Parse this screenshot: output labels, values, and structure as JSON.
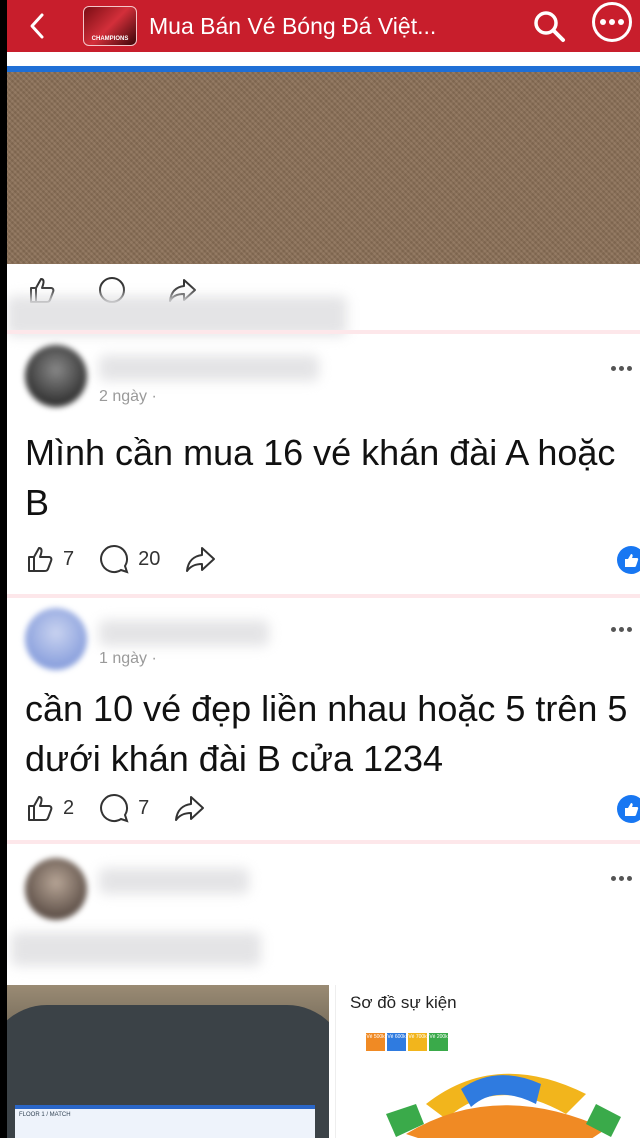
{
  "header": {
    "group_title": "Mua Bán Vé Bóng Đá Việt...",
    "avatar_caption": "CHAMPIONS",
    "icons": [
      "chevron-left-icon",
      "search-icon",
      "more-icon"
    ],
    "accent_color": "#c81e2c"
  },
  "posts": [
    {
      "meta": "2 ngày ·",
      "text": "Mình cần mua 16 vé khán đài A hoặc B",
      "likes": "7",
      "comments": "20"
    },
    {
      "meta": "1 ngày ·",
      "text": "cần 10 vé đẹp liền nhau hoặc 5 trên 5 dưới khán đài B cửa 1234",
      "likes": "2",
      "comments": "7"
    }
  ],
  "third_post": {
    "map_title": "Sơ đồ sự kiện",
    "legend": [
      "Vé 500k",
      "Vé 600k",
      "Vé 700k",
      "Vé 200k"
    ],
    "ticket_caption": "FLOOR 1 / MATCH"
  }
}
